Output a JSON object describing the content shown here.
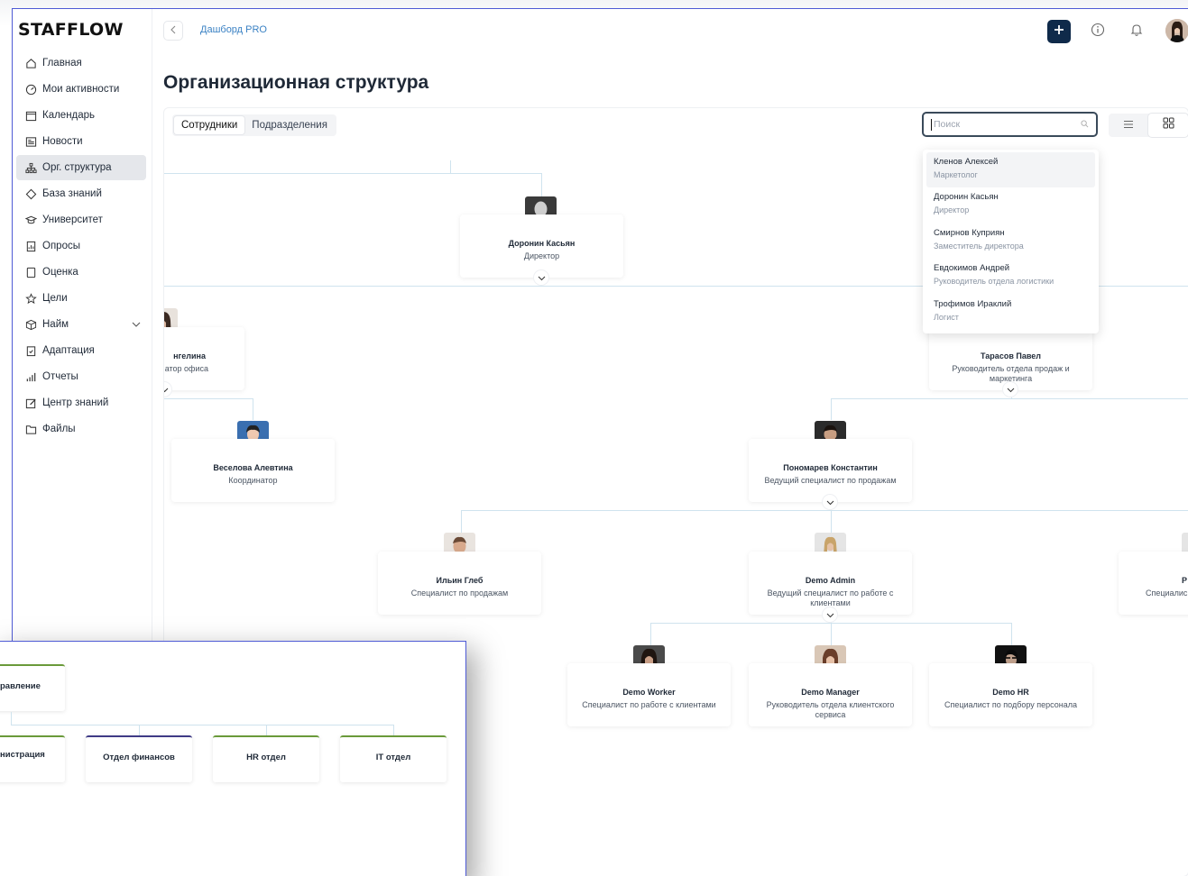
{
  "app": {
    "logo": "STAFFLOW"
  },
  "sidebar": {
    "items": [
      {
        "label": "Главная",
        "icon": "home-icon"
      },
      {
        "label": "Мои активности",
        "icon": "gauge-icon"
      },
      {
        "label": "Календарь",
        "icon": "calendar-icon"
      },
      {
        "label": "Новости",
        "icon": "newspaper-icon"
      },
      {
        "label": "Орг. структура",
        "icon": "org-chart-icon",
        "active": true
      },
      {
        "label": "База знаний",
        "icon": "diamond-icon"
      },
      {
        "label": "Университет",
        "icon": "graduation-cap-icon"
      },
      {
        "label": "Опросы",
        "icon": "survey-icon"
      },
      {
        "label": "Оценка",
        "icon": "document-icon"
      },
      {
        "label": "Цели",
        "icon": "star-icon"
      },
      {
        "label": "Найм",
        "icon": "box-icon",
        "expandable": true
      },
      {
        "label": "Адаптация",
        "icon": "clipboard-check-icon"
      },
      {
        "label": "Отчеты",
        "icon": "bar-chart-icon"
      },
      {
        "label": "Центр знаний",
        "icon": "edit-icon"
      },
      {
        "label": "Файлы",
        "icon": "folder-icon"
      }
    ]
  },
  "header": {
    "breadcrumb": "Дашборд PRO",
    "title": "Организационная структура"
  },
  "tabs": [
    {
      "label": "Сотрудники",
      "active": true
    },
    {
      "label": "Подразделения",
      "active": false
    }
  ],
  "search": {
    "placeholder": "Поиск"
  },
  "search_results": [
    {
      "name": "Кленов Алексей",
      "role": "Маркетолог"
    },
    {
      "name": "Доронин Касьян",
      "role": "Директор"
    },
    {
      "name": "Смирнов Куприян",
      "role": "Заместитель директора"
    },
    {
      "name": "Евдокимов Андрей",
      "role": "Руководитель отдела логистики"
    },
    {
      "name": "Трофимов Ираклий",
      "role": "Логист"
    }
  ],
  "org": {
    "director": {
      "name": "Доронин Касьян",
      "role": "Директор"
    },
    "office": {
      "name": "нгелина",
      "role": "атор офиса"
    },
    "sales_head": {
      "name": "Тарасов Павел",
      "role": "Руководитель отдела продаж и маркетинга"
    },
    "coordinator": {
      "name": "Веселова Алевтина",
      "role": "Координатор"
    },
    "lead_sales": {
      "name": "Пономарев Константин",
      "role": "Ведущий специалист по продажам"
    },
    "sales_spec": {
      "name": "Ильин Глеб",
      "role": "Специалист по продажам"
    },
    "demo_admin": {
      "name": "Demo Admin",
      "role": "Ведущий специалист по работе с клиентами"
    },
    "partial_right": {
      "name": "Р",
      "role": "Специалис"
    },
    "demo_worker": {
      "name": "Demo Worker",
      "role": "Специалист по работе с клиентами"
    },
    "demo_manager": {
      "name": "Demo Manager",
      "role": "Руководитель отдела клиентского сервиса"
    },
    "demo_hr": {
      "name": "Demo HR",
      "role": "Специалист по подбору персонала"
    }
  },
  "departments": {
    "top": "равление",
    "items": [
      "нистрация",
      "Отдел финансов",
      "HR отдел",
      "IT отдел"
    ]
  },
  "colors": {
    "accent": "#0f2a4a",
    "link": "#3b82c4",
    "connector": "#cfe3ee",
    "dept_green": "#6a9a3a",
    "dept_purple": "#3f3b86"
  }
}
